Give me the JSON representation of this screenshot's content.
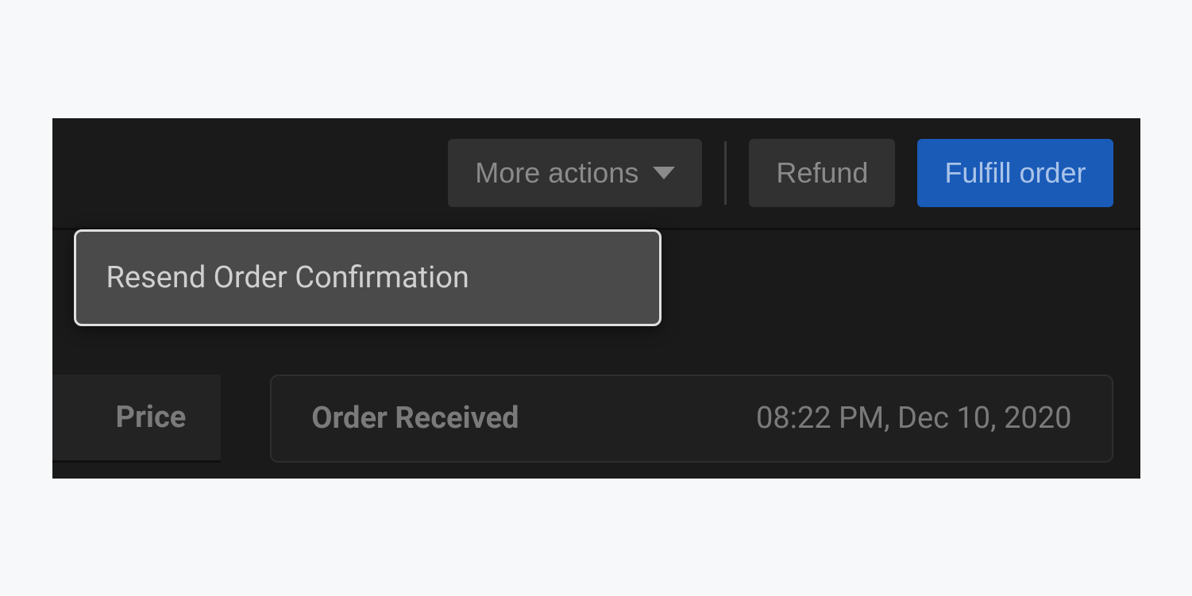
{
  "toolbar": {
    "more_actions_label": "More actions",
    "refund_label": "Refund",
    "fulfill_label": "Fulfill order"
  },
  "dropdown": {
    "resend_confirmation_label": "Resend Order Confirmation"
  },
  "details": {
    "price_label": "Price",
    "order_received_label": "Order Received",
    "order_received_value": "08:22 PM, Dec 10, 2020"
  }
}
